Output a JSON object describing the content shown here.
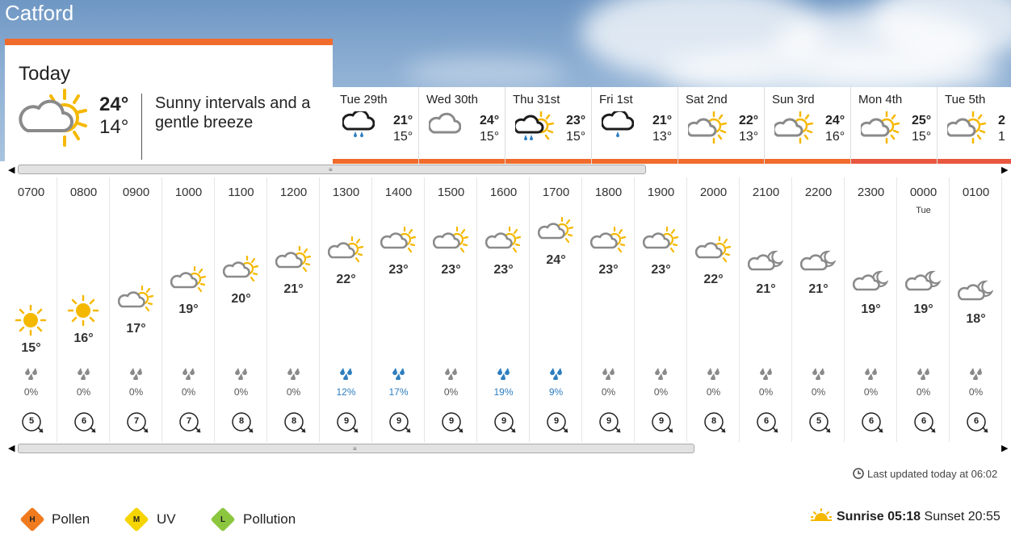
{
  "location": "Catford",
  "today": {
    "title": "Today",
    "max": "24°",
    "min": "14°",
    "description": "Sunny intervals and a gentle breeze",
    "icon": "sunny-intervals"
  },
  "days": [
    {
      "name": "Tue 29th",
      "hi": "21°",
      "lo": "15°",
      "icon": "rain-cloud",
      "bar": "#f06b2c"
    },
    {
      "name": "Wed 30th",
      "hi": "24°",
      "lo": "15°",
      "icon": "cloud",
      "bar": "#f06b2c"
    },
    {
      "name": "Thu 31st",
      "hi": "23°",
      "lo": "15°",
      "icon": "sun-rain",
      "bar": "#f06b2c"
    },
    {
      "name": "Fri 1st",
      "hi": "21°",
      "lo": "13°",
      "icon": "rain-cloud",
      "bar": "#f06b2c"
    },
    {
      "name": "Sat 2nd",
      "hi": "22°",
      "lo": "13°",
      "icon": "sunny-intervals",
      "bar": "#f06b2c"
    },
    {
      "name": "Sun 3rd",
      "hi": "24°",
      "lo": "16°",
      "icon": "sunny-intervals",
      "bar": "#f06b2c"
    },
    {
      "name": "Mon 4th",
      "hi": "25°",
      "lo": "15°",
      "icon": "sunny-intervals",
      "bar": "#e9573f"
    },
    {
      "name": "Tue 5th",
      "hi": "2",
      "lo": "1",
      "icon": "sunny-intervals",
      "bar": "#e9573f"
    }
  ],
  "hours": [
    {
      "time": "0700",
      "day": "",
      "temp": "15°",
      "icon": "sun",
      "rain": "0%",
      "wind": "5"
    },
    {
      "time": "0800",
      "day": "",
      "temp": "16°",
      "icon": "sun",
      "rain": "0%",
      "wind": "6"
    },
    {
      "time": "0900",
      "day": "",
      "temp": "17°",
      "icon": "sunny-intervals",
      "rain": "0%",
      "wind": "7"
    },
    {
      "time": "1000",
      "day": "",
      "temp": "19°",
      "icon": "sunny-intervals",
      "rain": "0%",
      "wind": "7"
    },
    {
      "time": "1100",
      "day": "",
      "temp": "20°",
      "icon": "sunny-intervals",
      "rain": "0%",
      "wind": "8"
    },
    {
      "time": "1200",
      "day": "",
      "temp": "21°",
      "icon": "sunny-intervals",
      "rain": "0%",
      "wind": "8"
    },
    {
      "time": "1300",
      "day": "",
      "temp": "22°",
      "icon": "sunny-intervals",
      "rain": "12%",
      "wind": "9"
    },
    {
      "time": "1400",
      "day": "",
      "temp": "23°",
      "icon": "sunny-intervals",
      "rain": "17%",
      "wind": "9"
    },
    {
      "time": "1500",
      "day": "",
      "temp": "23°",
      "icon": "sunny-intervals",
      "rain": "0%",
      "wind": "9"
    },
    {
      "time": "1600",
      "day": "",
      "temp": "23°",
      "icon": "sunny-intervals",
      "rain": "19%",
      "wind": "9"
    },
    {
      "time": "1700",
      "day": "",
      "temp": "24°",
      "icon": "sunny-intervals",
      "rain": "9%",
      "wind": "9"
    },
    {
      "time": "1800",
      "day": "",
      "temp": "23°",
      "icon": "sunny-intervals",
      "rain": "0%",
      "wind": "9"
    },
    {
      "time": "1900",
      "day": "",
      "temp": "23°",
      "icon": "sunny-intervals",
      "rain": "0%",
      "wind": "9"
    },
    {
      "time": "2000",
      "day": "",
      "temp": "22°",
      "icon": "sunny-intervals",
      "rain": "0%",
      "wind": "8"
    },
    {
      "time": "2100",
      "day": "",
      "temp": "21°",
      "icon": "moon-cloud",
      "rain": "0%",
      "wind": "6"
    },
    {
      "time": "2200",
      "day": "",
      "temp": "21°",
      "icon": "moon-cloud",
      "rain": "0%",
      "wind": "5"
    },
    {
      "time": "2300",
      "day": "",
      "temp": "19°",
      "icon": "moon-cloud",
      "rain": "0%",
      "wind": "6"
    },
    {
      "time": "0000",
      "day": "Tue",
      "temp": "19°",
      "icon": "moon-cloud",
      "rain": "0%",
      "wind": "6"
    },
    {
      "time": "0100",
      "day": "",
      "temp": "18°",
      "icon": "moon-cloud",
      "rain": "0%",
      "wind": "6"
    }
  ],
  "last_updated": "Last updated today at 06:02",
  "legend": [
    {
      "letter": "H",
      "label": "Pollen",
      "color": "#f07b1f"
    },
    {
      "letter": "M",
      "label": "UV",
      "color": "#f5d400"
    },
    {
      "letter": "L",
      "label": "Pollution",
      "color": "#8cc63f"
    }
  ],
  "sun": {
    "sunrise_label": "Sunrise",
    "sunrise": "05:18",
    "sunset_label": "Sunset",
    "sunset": "20:55"
  },
  "colors": {
    "accent": "#f06b2c",
    "rain_text": "#2e7ec0",
    "sun": "#f5b800",
    "cloud": "#8a8a8a"
  }
}
